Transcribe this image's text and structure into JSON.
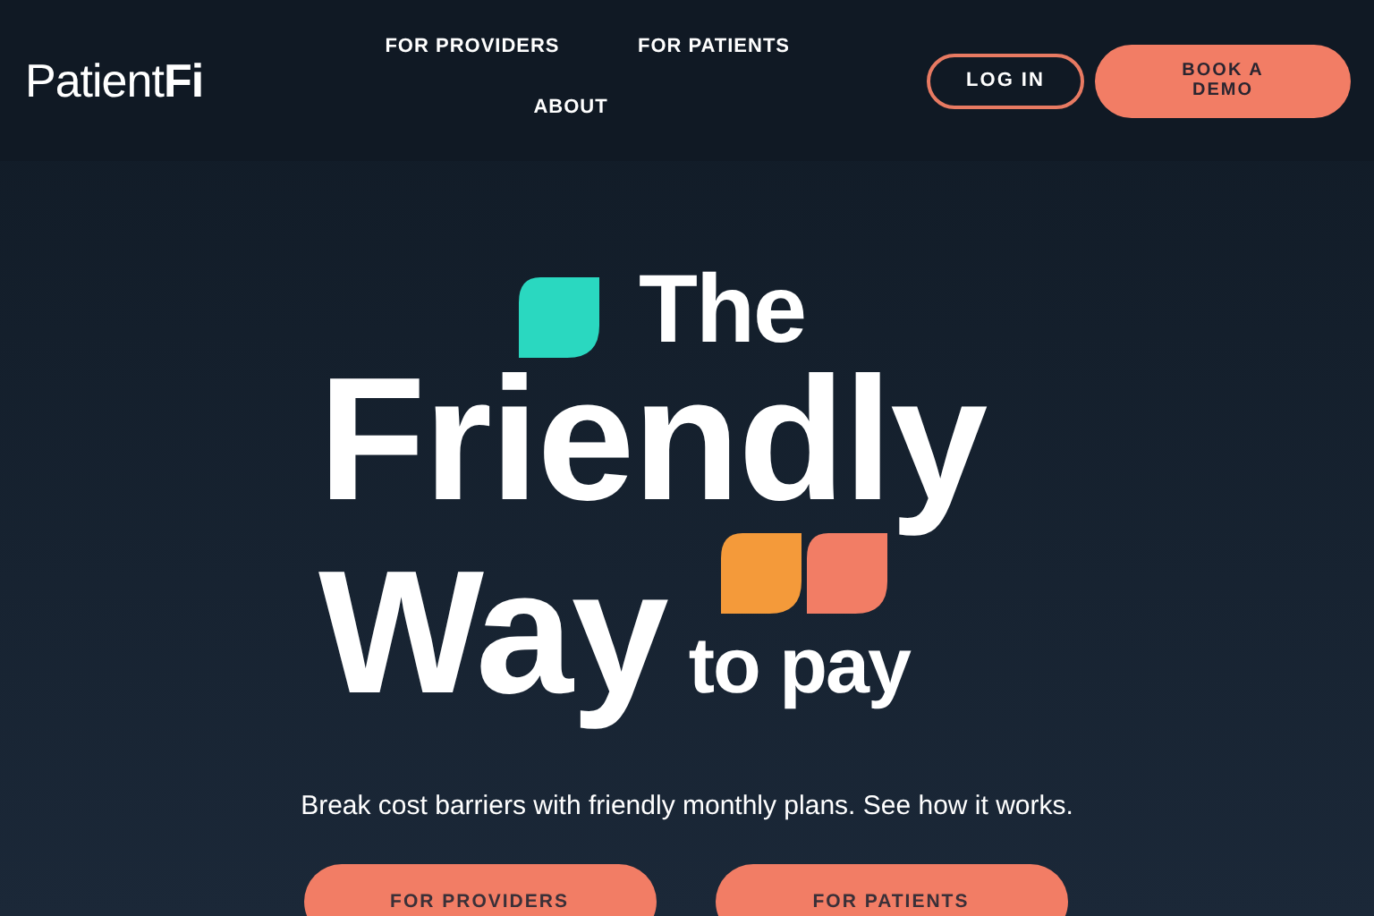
{
  "header": {
    "logo": "Patient**Fi**",
    "nav": [
      {
        "label": "FOR PROVIDERS"
      },
      {
        "label": "FOR PATIENTS"
      },
      {
        "label": "ABOUT"
      }
    ],
    "login": "LOG IN",
    "book_demo": "BOOK A DEMO"
  },
  "hero": {
    "headline": [
      "The",
      "Friendly",
      "Way",
      "to pay"
    ],
    "subtitle": "Break cost barriers with friendly monthly plans. See how it works.",
    "buttons": [
      "FOR PROVIDERS",
      "FOR PATIENTS"
    ]
  }
}
